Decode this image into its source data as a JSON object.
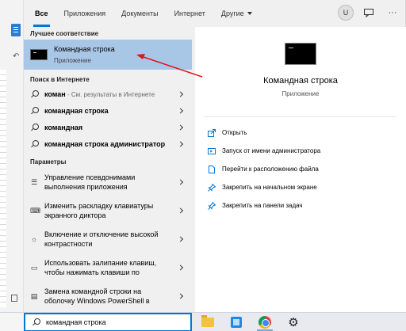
{
  "tabs": [
    {
      "label": "Все",
      "active": true
    },
    {
      "label": "Приложения"
    },
    {
      "label": "Документы"
    },
    {
      "label": "Интернет"
    },
    {
      "label": "Другие"
    }
  ],
  "user_initial": "U",
  "icons": {
    "feedback": "feedback-icon",
    "more": "more-icon",
    "search": "search-icon",
    "cmd": "cmd-icon",
    "settings": "settings-icon"
  },
  "colors": {
    "accent": "#0078d7",
    "highlight": "#a8c7e6",
    "arrow": "#e0161a"
  },
  "best_match": {
    "header": "Лучшее соответствие",
    "title": "Командная строка",
    "subtitle": "Приложение"
  },
  "web": {
    "header": "Поиск в Интернете",
    "items": [
      {
        "bold": "коман",
        "hint": " - См. результаты в Интернете"
      },
      {
        "bold": "командная строка",
        "hint": ""
      },
      {
        "bold": "командная",
        "hint": ""
      },
      {
        "bold": "командная строка администратор",
        "hint": ""
      }
    ]
  },
  "settings": {
    "header": "Параметры",
    "items": [
      {
        "line1": "Управление псевдонимами",
        "line2": "выполнения приложения"
      },
      {
        "line1": "Изменить раскладку клавиатуры",
        "line2": "экранного диктора"
      },
      {
        "line1": "Включение и отключение высокой",
        "line2": "контрастности"
      },
      {
        "line1": "Использовать залипание клавиш,",
        "line2": "чтобы нажимать клавиши по"
      },
      {
        "line1": "Замена командной строки на",
        "line2": "оболочку Windows PowerShell в"
      }
    ]
  },
  "detail": {
    "title": "Командная строка",
    "subtitle": "Приложение",
    "actions": [
      {
        "label": "Открыть",
        "icon": "open-icon"
      },
      {
        "label": "Запуск от имени администратора",
        "icon": "admin-icon"
      },
      {
        "label": "Перейти к расположению файла",
        "icon": "file-location-icon"
      },
      {
        "label": "Закрепить на начальном экране",
        "icon": "pin-start-icon"
      },
      {
        "label": "Закрепить на панели задач",
        "icon": "pin-taskbar-icon"
      }
    ]
  },
  "search": {
    "value": "командная строка"
  }
}
